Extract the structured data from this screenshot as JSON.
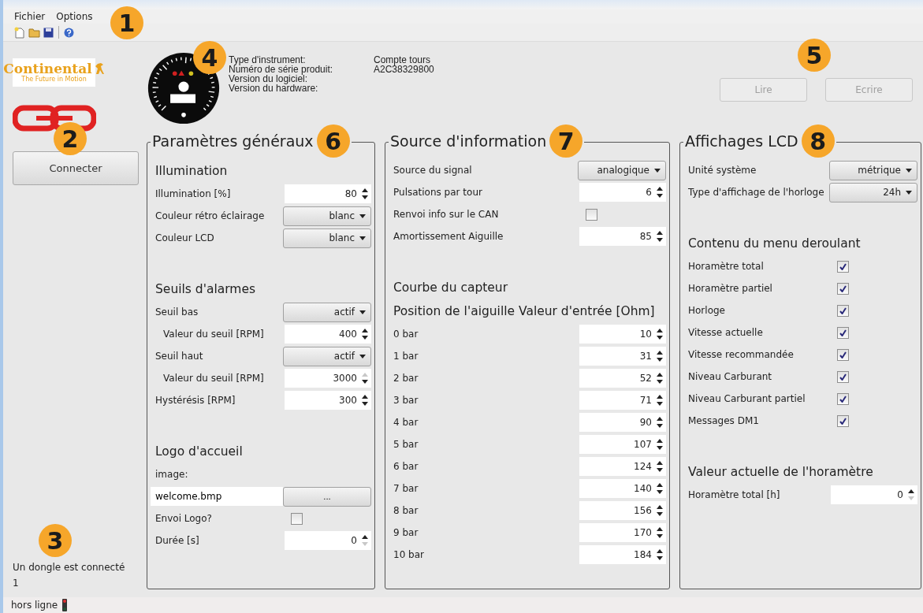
{
  "menu": [
    "Fichier",
    "Options"
  ],
  "callouts": [
    "1",
    "2",
    "3",
    "4",
    "5"
  ],
  "brand": {
    "wordmark": "Continental",
    "tagline": "The Future in Motion"
  },
  "connect_button": "Connecter",
  "dongle_status": [
    "Un dongle est connecté",
    "1"
  ],
  "instrument_info": [
    {
      "label": "Type d'instrument:",
      "value": "Compte tours"
    },
    {
      "label": "Numéro de série produit:",
      "value": "A2C38329800"
    },
    {
      "label": "Version du logiciel:"
    },
    {
      "label": "Version du hardware:"
    }
  ],
  "actions": [
    {
      "label": "Lire",
      "disabled": true
    },
    {
      "label": "Ecrire",
      "disabled": true
    }
  ],
  "panels": [
    {
      "title": "Paramètres généraux",
      "callout": "6",
      "sections": [
        {
          "heading": "Illumination",
          "items": [
            {
              "kind": "spin",
              "label": "Illumination [%]",
              "value": "80",
              "at_max": false,
              "at_min": false
            },
            {
              "kind": "dropdown",
              "label": "Couleur rétro éclairage",
              "value": "blanc"
            },
            {
              "kind": "dropdown",
              "label": "Couleur LCD",
              "value": "blanc"
            }
          ]
        },
        {
          "heading": "Seuils d'alarmes",
          "items": [
            {
              "kind": "dropdown",
              "label": "Seuil bas",
              "value": "actif",
              "children": [
                {
                  "kind": "spin",
                  "label": "Valeur du seuil [RPM]",
                  "value": "400",
                  "at_max": false,
                  "at_min": false
                }
              ]
            },
            {
              "kind": "dropdown",
              "label": "Seuil haut",
              "value": "actif",
              "children": [
                {
                  "kind": "spin",
                  "label": "Valeur du seuil [RPM]",
                  "value": "3000",
                  "at_max": true,
                  "at_min": false
                }
              ]
            },
            {
              "kind": "spin",
              "label": "Hystérésis [RPM]",
              "value": "300",
              "at_max": false,
              "at_min": false
            }
          ]
        },
        {
          "heading": "Logo d'accueil",
          "items": [
            {
              "kind": "label",
              "label": "image:"
            },
            {
              "kind": "file",
              "value": "welcome.bmp",
              "button": "..."
            },
            {
              "kind": "checkbox",
              "label": "Envoi Logo?",
              "checked": false
            },
            {
              "kind": "spin",
              "label": "Durée [s]",
              "value": "0",
              "at_max": false,
              "at_min": true
            }
          ]
        }
      ]
    },
    {
      "title": "Source d'information",
      "callout": "7",
      "sections": [
        {
          "items": [
            {
              "kind": "dropdown",
              "label": "Source du signal",
              "value": "analogique"
            },
            {
              "kind": "spin",
              "label": "Pulsations par tour",
              "value": "6",
              "at_max": false,
              "at_min": false
            },
            {
              "kind": "checkbox",
              "label": "Renvoi info sur le CAN",
              "checked": false
            },
            {
              "kind": "spin",
              "label": "Amortissement Aiguille",
              "value": "85",
              "at_max": false,
              "at_min": false
            }
          ]
        },
        {
          "heading": "Courbe du capteur",
          "subheading": "Position de l'aiguille Valeur d'entrée [Ohm]",
          "items": [
            {
              "kind": "spin",
              "label": "0 bar",
              "value": "10",
              "at_max": false,
              "at_min": false
            },
            {
              "kind": "spin",
              "label": "1 bar",
              "value": "31",
              "at_max": false,
              "at_min": false
            },
            {
              "kind": "spin",
              "label": "2 bar",
              "value": "52",
              "at_max": false,
              "at_min": false
            },
            {
              "kind": "spin",
              "label": "3 bar",
              "value": "71",
              "at_max": false,
              "at_min": false
            },
            {
              "kind": "spin",
              "label": "4 bar",
              "value": "90",
              "at_max": false,
              "at_min": false
            },
            {
              "kind": "spin",
              "label": "5 bar",
              "value": "107",
              "at_max": false,
              "at_min": false
            },
            {
              "kind": "spin",
              "label": "6 bar",
              "value": "124",
              "at_max": false,
              "at_min": false
            },
            {
              "kind": "spin",
              "label": "7 bar",
              "value": "140",
              "at_max": false,
              "at_min": false
            },
            {
              "kind": "spin",
              "label": "8 bar",
              "value": "156",
              "at_max": false,
              "at_min": false
            },
            {
              "kind": "spin",
              "label": "9 bar",
              "value": "170",
              "at_max": false,
              "at_min": false
            },
            {
              "kind": "spin",
              "label": "10 bar",
              "value": "184",
              "at_max": false,
              "at_min": false
            }
          ]
        }
      ]
    },
    {
      "title": "Affichages LCD",
      "callout": "8",
      "sections": [
        {
          "items": [
            {
              "kind": "dropdown",
              "label": "Unité système",
              "value": "métrique"
            },
            {
              "kind": "dropdown",
              "label": "Type d'affichage de l'horloge",
              "value": "24h"
            }
          ]
        },
        {
          "heading": "Contenu du menu deroulant",
          "items": [
            {
              "kind": "checkbox",
              "label": "Horamètre total",
              "checked": true
            },
            {
              "kind": "checkbox",
              "label": "Horamètre partiel",
              "checked": true
            },
            {
              "kind": "checkbox",
              "label": "Horloge",
              "checked": true
            },
            {
              "kind": "checkbox",
              "label": "Vitesse actuelle",
              "checked": true
            },
            {
              "kind": "checkbox",
              "label": "Vitesse recommandée",
              "checked": true
            },
            {
              "kind": "checkbox",
              "label": "Niveau Carburant",
              "checked": true
            },
            {
              "kind": "checkbox",
              "label": "Niveau Carburant partiel",
              "checked": true
            },
            {
              "kind": "checkbox",
              "label": "Messages DM1",
              "checked": true
            }
          ]
        },
        {
          "heading": "Valeur actuelle de l'horamètre",
          "items": [
            {
              "kind": "spin",
              "label": "Horamètre total [h]",
              "value": "0",
              "at_max": false,
              "at_min": true
            }
          ]
        }
      ]
    }
  ],
  "status_bar": {
    "text": "hors ligne",
    "online": false
  }
}
